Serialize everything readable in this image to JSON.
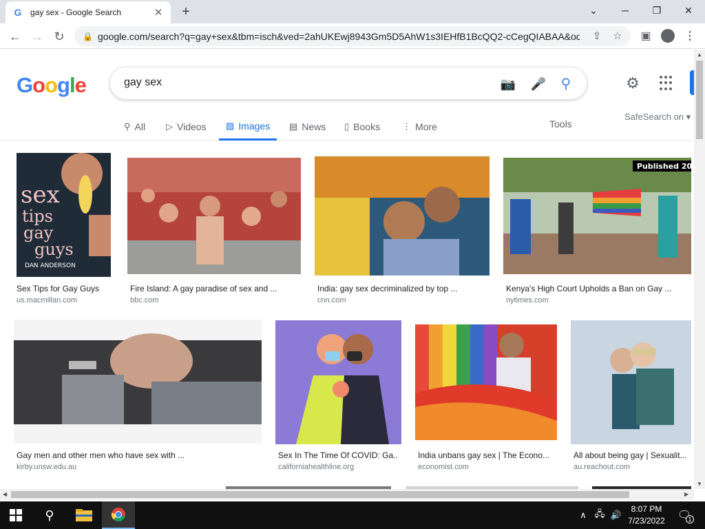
{
  "browser": {
    "tab_title": "gay sex - Google Search",
    "tab_favicon": "G",
    "url": "google.com/search?q=gay+sex&tbm=isch&ved=2ahUKEwj8943Gm5D5AhW1s3IEHfB1BcQQ2-cCegQIABAA&oq..."
  },
  "google": {
    "logo": [
      "G",
      "o",
      "o",
      "g",
      "l",
      "e"
    ],
    "logo_colors": [
      "#4285f4",
      "#ea4335",
      "#fbbc05",
      "#4285f4",
      "#34a853",
      "#ea4335"
    ],
    "query": "gay sex",
    "tabs": [
      {
        "label": "All",
        "icon": "search-icon"
      },
      {
        "label": "Videos",
        "icon": "play-icon"
      },
      {
        "label": "Images",
        "icon": "image-icon"
      },
      {
        "label": "News",
        "icon": "news-icon"
      },
      {
        "label": "Books",
        "icon": "book-icon"
      },
      {
        "label": "More",
        "icon": "more-vert-icon"
      }
    ],
    "tools": "Tools",
    "safesearch": "SafeSearch on"
  },
  "results": [
    {
      "caption": "Sex Tips for Gay Guys",
      "source": "us.macmillan.com",
      "book_lines": [
        "sex",
        "tips",
        "gay",
        "guys"
      ],
      "author": "DAN ANDERSON",
      "color": "#2c3e50"
    },
    {
      "caption": "Fire Island: A gay paradise of sex and ...",
      "source": "bbc.com",
      "color": "#b23a32"
    },
    {
      "caption": "India: gay sex decriminalized by top ...",
      "source": "cnn.com",
      "color": "#c9781e"
    },
    {
      "caption": "Kenya's High Court Upholds a Ban on Gay ...",
      "source": "nytimes.com",
      "badge": "Published 20",
      "color": "#6a8a4a"
    },
    {
      "caption": "Gay men and other men who have sex with ...",
      "source": "kirby.unsw.edu.au",
      "color": "#56585c"
    },
    {
      "caption": "Sex In The Time Of COVID: Ga...",
      "source": "californiahealthline.org",
      "color": "#8c7bd6"
    },
    {
      "caption": "India unbans gay sex | The Econo...",
      "source": "economist.com",
      "color": "#d6402a"
    },
    {
      "caption": "All about being gay | Sexualit...",
      "source": "au.reachout.com",
      "color": "#b9c9d9"
    }
  ],
  "taskbar": {
    "time": "8:07 PM",
    "date": "7/23/2022",
    "notification_count": "1"
  }
}
